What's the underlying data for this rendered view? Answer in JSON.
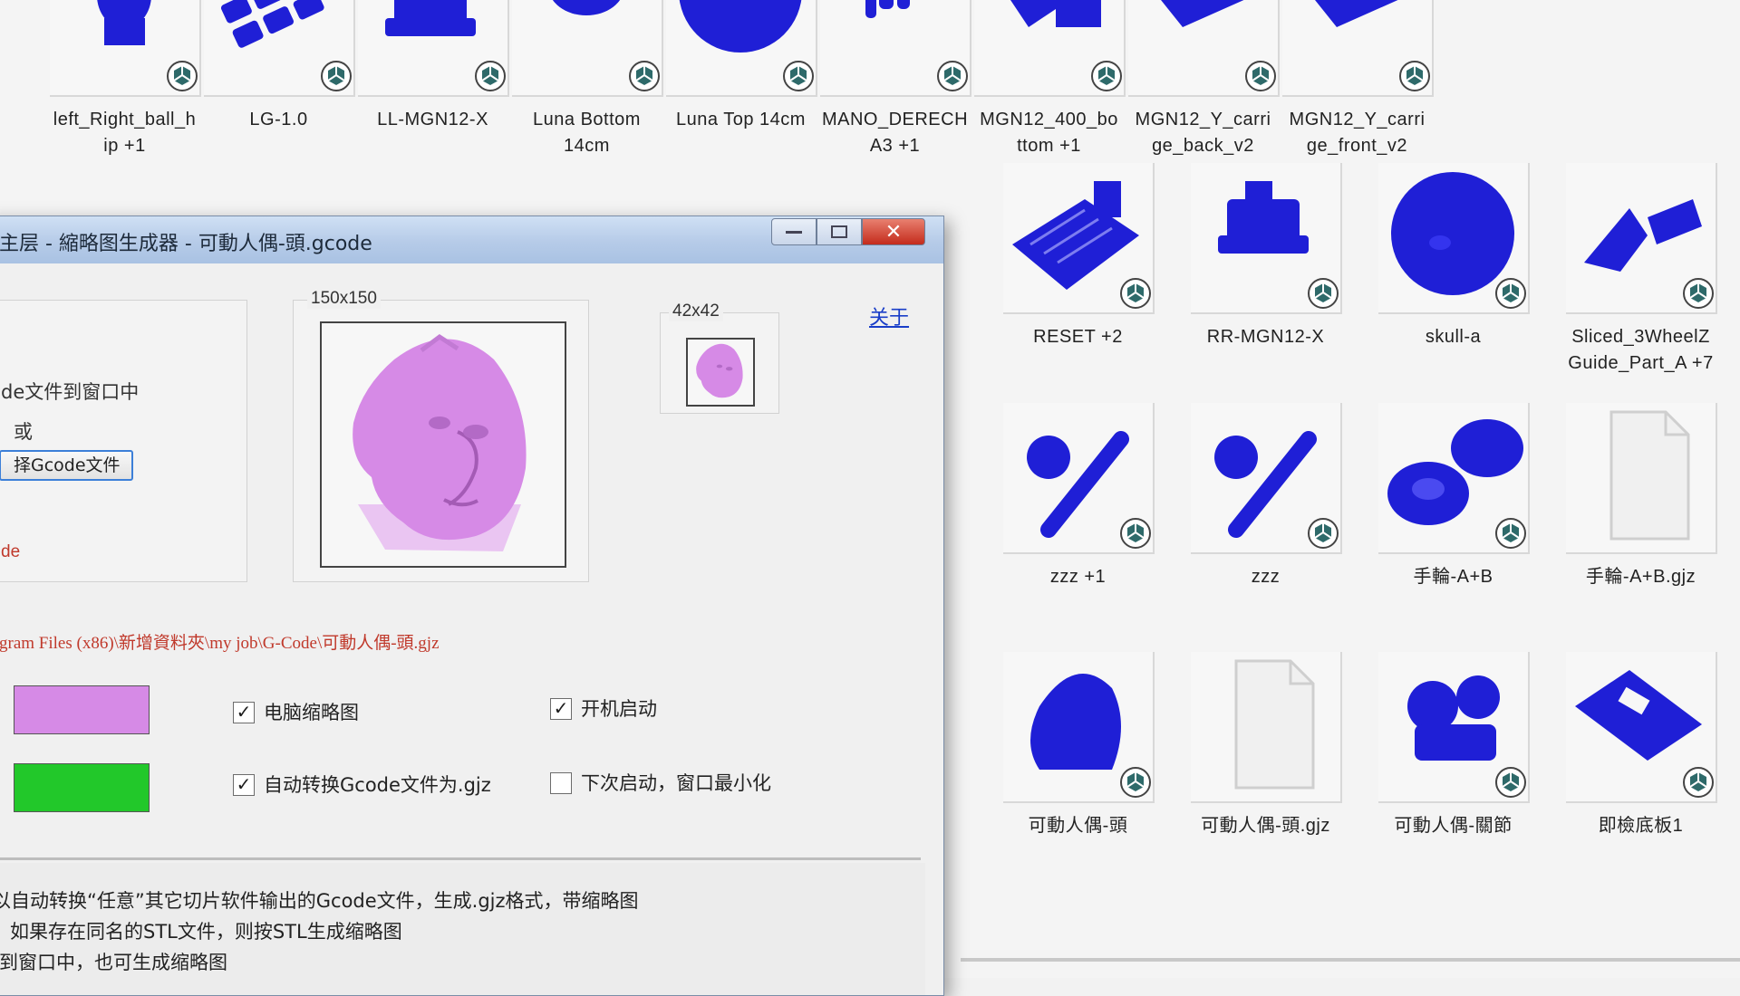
{
  "colors": {
    "model_blue": "#1f1fd6",
    "model_pink": "#d68ae6",
    "swatch_green": "#22c82a",
    "path_red": "#c0392b",
    "link_blue": "#1a3ec8"
  },
  "explorer": {
    "row1": [
      {
        "label": "left_Right_ball_h\nip +1",
        "icon": "figure-model"
      },
      {
        "label": "LG-1.0",
        "icon": "tray-model"
      },
      {
        "label": "LL-MGN12-X",
        "icon": "bracket-model"
      },
      {
        "label": "Luna Bottom\n14cm",
        "icon": "disc-model"
      },
      {
        "label": "Luna Top 14cm",
        "icon": "sphere-model"
      },
      {
        "label": "MANO_DERECH\nA3 +1",
        "icon": "hand-model"
      },
      {
        "label": "MGN12_400_bo\nttom +1",
        "icon": "plate-model"
      },
      {
        "label": "MGN12_Y_carri\nge_back_v2",
        "icon": "carriage-model"
      },
      {
        "label": "MGN12_Y_carri\nge_front_v2",
        "icon": "carriage-model"
      }
    ],
    "row2": [
      {
        "label": "RESET +2",
        "icon": "grid-plate-model"
      },
      {
        "label": "RR-MGN12-X",
        "icon": "bracket-model"
      },
      {
        "label": "skull-a",
        "icon": "skull-model"
      },
      {
        "label": "Sliced_3WheelZ\nGuide_Part_A +7",
        "icon": "guide-model"
      }
    ],
    "row3": [
      {
        "label": "zzz +1",
        "icon": "wrench-model"
      },
      {
        "label": "zzz",
        "icon": "wrench-model"
      },
      {
        "label": "手輪-A+B",
        "icon": "wheel-model"
      },
      {
        "label": "手輪-A+B.gjz",
        "icon": "blank-file-icon"
      }
    ],
    "row4": [
      {
        "label": "可動人偶-頭",
        "icon": "head-model"
      },
      {
        "label": "可動人偶-頭.gjz",
        "icon": "blank-file-icon"
      },
      {
        "label": "可動人偶-關節",
        "icon": "joints-model"
      },
      {
        "label": "即檢底板1",
        "icon": "base-plate-model"
      }
    ]
  },
  "dialog": {
    "title": "主层 - 縮略图生成器 - 可動人偶-頭.gcode",
    "size_150": "150x150",
    "size_42": "42x42",
    "about_link": "关于",
    "drag_text": "de文件到窗口中",
    "or_text": "或",
    "select_button": "择Gcode文件",
    "left_red_text": "de",
    "path": "gram Files (x86)\\新增資料夾\\my job\\G-Code\\可動人偶-頭.gjz",
    "check_thumb_label": "电脑缩略图",
    "check_thumb_checked": "✓",
    "check_startup_label": "开机启动",
    "check_startup_checked": "✓",
    "check_autoconvert_label": "自动转换Gcode文件为.gjz",
    "check_autoconvert_checked": "✓",
    "check_minimize_label": "下次启动，窗口最小化",
    "check_minimize_checked": "",
    "info_line1": "以自动转换“任意”其它切片软件输出的Gcode文件，生成.gjz格式，带缩略图",
    "info_line2": "如果存在同名的STL文件，则按STL生成缩略图",
    "info_line3": "到窗口中，也可生成缩略图",
    "swatch1_color": "#d68ae6",
    "swatch2_color": "#22c82a"
  }
}
